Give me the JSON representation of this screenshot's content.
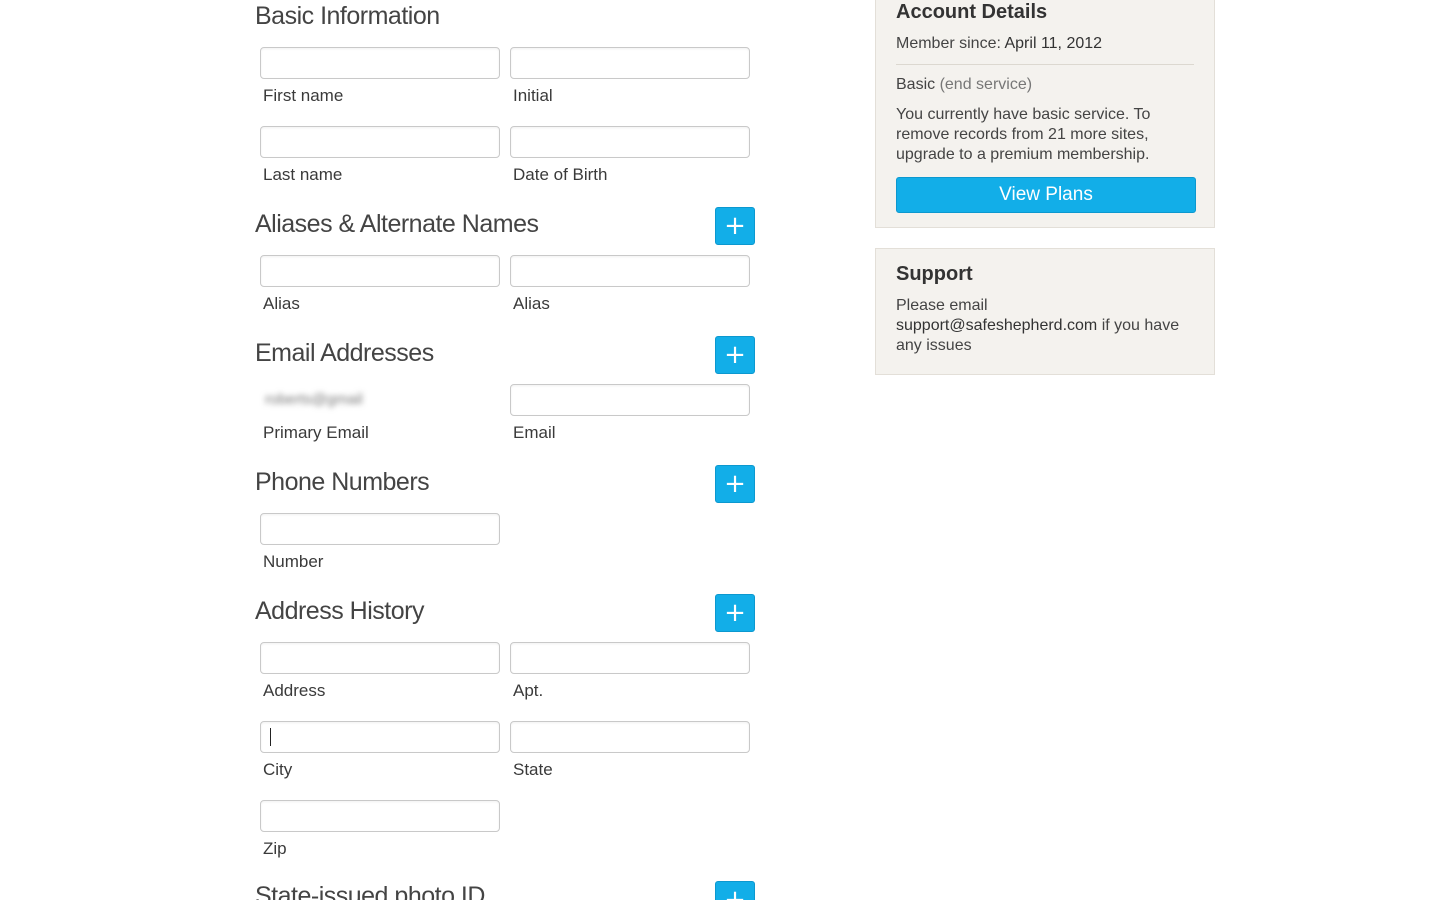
{
  "sections": {
    "basic": {
      "title": "Basic Information",
      "first_name_label": "First name",
      "initial_label": "Initial",
      "last_name_label": "Last name",
      "dob_label": "Date of Birth"
    },
    "aliases": {
      "title": "Aliases & Alternate Names",
      "add_label": "+",
      "alias1_label": "Alias",
      "alias2_label": "Alias"
    },
    "emails": {
      "title": "Email Addresses",
      "add_label": "+",
      "primary_value": "roberts@gmail",
      "primary_label": "Primary Email",
      "email_label": "Email"
    },
    "phones": {
      "title": "Phone Numbers",
      "add_label": "+",
      "number_label": "Number"
    },
    "address": {
      "title": "Address History",
      "add_label": "+",
      "address_label": "Address",
      "apt_label": "Apt.",
      "city_label": "City",
      "state_label": "State",
      "zip_label": "Zip"
    },
    "photo_id": {
      "title": "State-issued photo ID",
      "add_label": "+"
    }
  },
  "account": {
    "title": "Account Details",
    "member_since_label": "Member since:",
    "member_since_value": "April 11, 2012",
    "plan_name": "Basic",
    "end_service": "(end service)",
    "description": "You currently have basic service. To remove records from 21 more sites, upgrade to a premium membership.",
    "view_plans_label": "View Plans"
  },
  "support": {
    "title": "Support",
    "text_before": "Please email",
    "email": "support@safeshepherd.com",
    "text_after": "if you have any issues"
  },
  "colors": {
    "accent": "#12aee8",
    "panel_bg": "#f4f2ee"
  }
}
